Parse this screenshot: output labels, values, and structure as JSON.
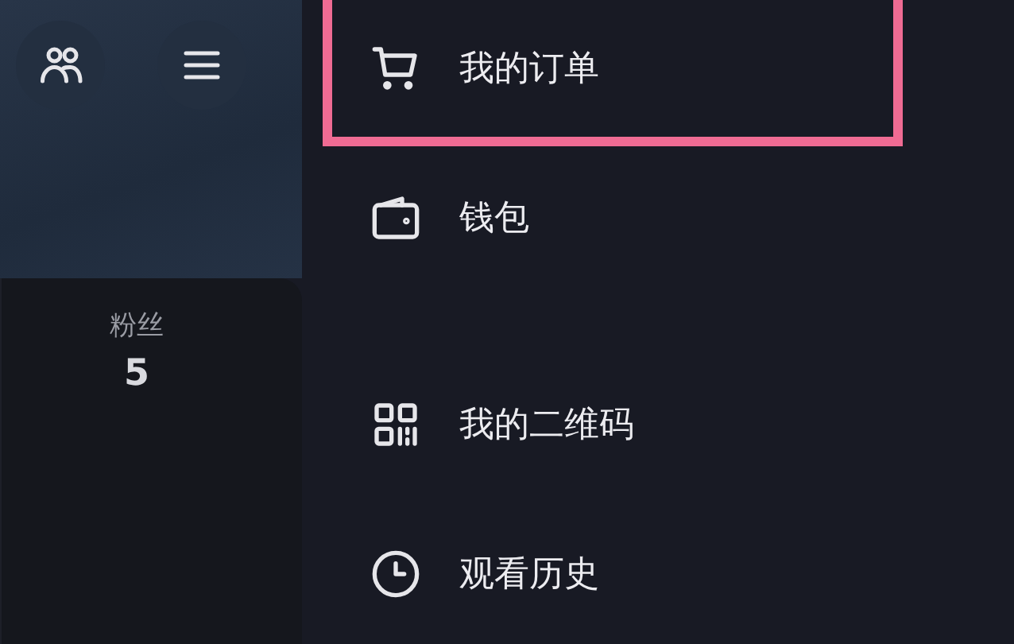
{
  "header": {
    "buttons": [
      {
        "kind": "friends"
      },
      {
        "kind": "menu"
      }
    ]
  },
  "stats": [
    {
      "label": "粉丝",
      "value": "5"
    }
  ],
  "menu": {
    "sections": [
      {
        "items": [
          {
            "kind": "cart",
            "label": "我的订单",
            "highlighted": true
          },
          {
            "kind": "wallet",
            "label": "钱包",
            "highlighted": false
          }
        ]
      },
      {
        "items": [
          {
            "kind": "qrcode",
            "label": "我的二维码",
            "highlighted": false
          },
          {
            "kind": "clock",
            "label": "观看历史",
            "highlighted": false
          }
        ]
      }
    ]
  }
}
